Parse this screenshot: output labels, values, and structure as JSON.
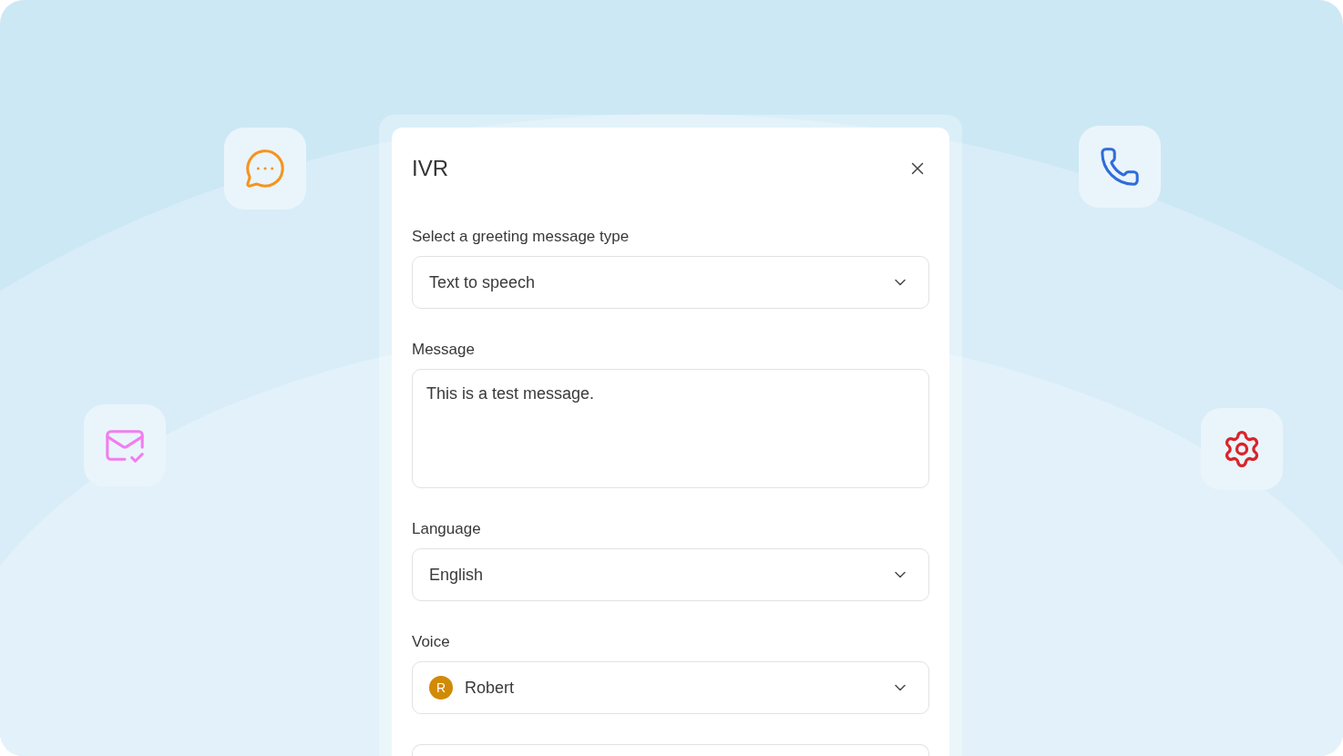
{
  "dialog": {
    "title": "IVR",
    "fields": [
      {
        "kind": "select",
        "label": "Select a greeting message type",
        "value": "Text to speech"
      },
      {
        "kind": "textarea",
        "label": "Message",
        "value": "This is a test message."
      },
      {
        "kind": "select",
        "label": "Language",
        "value": "English"
      },
      {
        "kind": "select",
        "label": "Voice",
        "value": "Robert",
        "avatar": "R"
      }
    ]
  }
}
